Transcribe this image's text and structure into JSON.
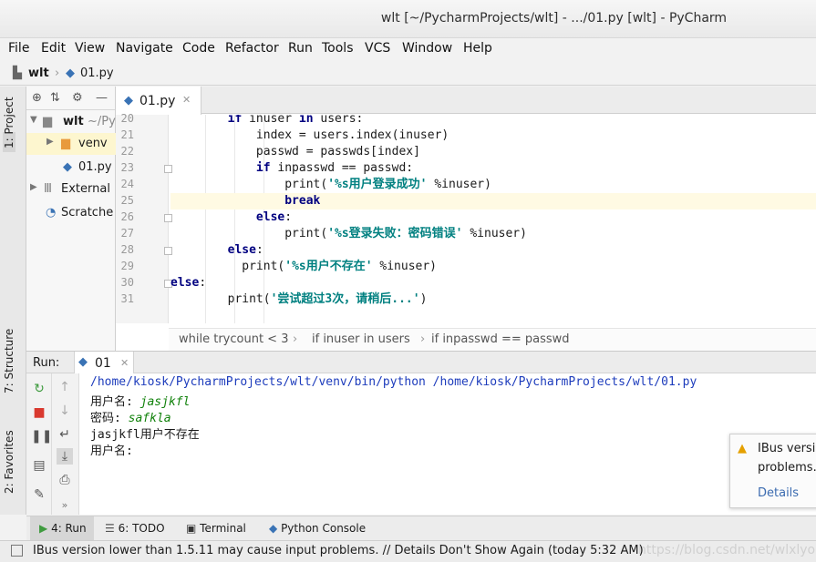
{
  "window": {
    "title": "wlt [~/PycharmProjects/wlt] - .../01.py [wlt] - PyCharm"
  },
  "menu": [
    "File",
    "Edit",
    "View",
    "Navigate",
    "Code",
    "Refactor",
    "Run",
    "Tools",
    "VCS",
    "Window",
    "Help"
  ],
  "nav": {
    "project": "wlt",
    "file": "01.py"
  },
  "left_strip": {
    "project_tab": "1: Project",
    "structure_tab": "7: Structure",
    "favorites_tab": "2: Favorites"
  },
  "project_tree": [
    {
      "label": "wlt",
      "suffix": "~/Py",
      "icon": "folder-icon"
    },
    {
      "label": "venv",
      "icon": "folder-icon"
    },
    {
      "label": "01.py",
      "icon": "python-file-icon"
    },
    {
      "label": "External",
      "icon": "library-icon"
    },
    {
      "label": "Scratche",
      "icon": "scratch-icon"
    }
  ],
  "editor": {
    "tab": "01.py",
    "line_numbers": [
      "20",
      "21",
      "22",
      "23",
      "24",
      "25",
      "26",
      "27",
      "28",
      "29",
      "30",
      "31"
    ],
    "lines": [
      {
        "indent": "        ",
        "kw": "if",
        "rest": " inuser ",
        "kw2": "in",
        "rest2": " users:"
      },
      {
        "indent": "            ",
        "text": "index = users.index(inuser)"
      },
      {
        "indent": "            ",
        "text": "passwd = passwds[index]"
      },
      {
        "indent": "            ",
        "kw": "if",
        "rest": " inpasswd == passwd:"
      },
      {
        "indent": "                ",
        "fn": "print(",
        "str": "'%s用户登录成功'",
        "rest": " %inuser)"
      },
      {
        "indent": "                ",
        "kw": "break"
      },
      {
        "indent": "            ",
        "kw": "else",
        "rest": ":"
      },
      {
        "indent": "                ",
        "fn": "print(",
        "str": "'%s登录失败：密码错误'",
        "rest": " %inuser)"
      },
      {
        "indent": "        ",
        "kw": "else",
        "rest": ":"
      },
      {
        "indent": "          ",
        "fn": "print(",
        "str": "'%s用户不存在'",
        "rest": " %inuser)"
      },
      {
        "indent": "",
        "kw": "else",
        "rest": ":"
      },
      {
        "indent": "        ",
        "fn": "print(",
        "str": "'尝试超过3次，请稍后...'",
        "rest": ")"
      }
    ],
    "breadcrumb": [
      "while trycount < 3",
      "if inuser in users",
      "if inpasswd == passwd"
    ]
  },
  "run": {
    "label": "Run:",
    "tab": "01",
    "console": {
      "command": "/home/kiosk/PycharmProjects/wlt/venv/bin/python /home/kiosk/PycharmProjects/wlt/01.py",
      "prompt_user": "用户名: ",
      "input_user": "jasjkfl",
      "prompt_pass": "密码: ",
      "input_pass": "safkla",
      "result": "jasjkfl用户不存在",
      "prompt_user2": "用户名:"
    }
  },
  "notification": {
    "line1": "IBus versi",
    "line2": "problems.",
    "link": "Details"
  },
  "bottom_tabs": [
    "4: Run",
    "6: TODO",
    "Terminal",
    "Python Console"
  ],
  "status": {
    "message": "IBus version lower than 1.5.11 may cause input problems. // Details Don't Show Again (today 5:32 AM)",
    "watermark": "https://blog.csdn.net/wlxlyou"
  },
  "colors": {
    "keyword": "#000080",
    "string": "#008080",
    "console_path": "#1d3cbc",
    "console_input": "#10810a",
    "current_line": "#fffae3"
  }
}
